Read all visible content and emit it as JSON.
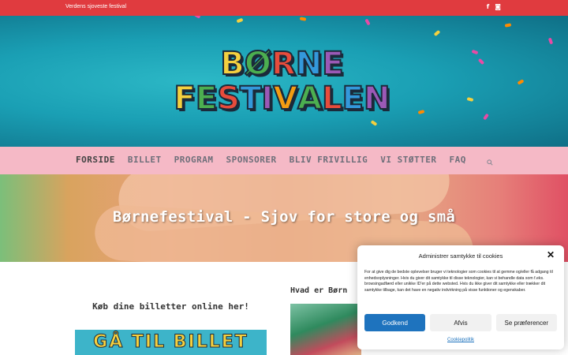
{
  "topbar": {
    "tagline": "Verdens sjoveste festival",
    "social": [
      {
        "icon": "facebook-icon",
        "glyph": "f"
      },
      {
        "icon": "instagram-icon",
        "glyph": "◙"
      }
    ]
  },
  "logo": {
    "row1": [
      "B",
      "Ø",
      "R",
      "N",
      "E"
    ],
    "row2": [
      "F",
      "E",
      "S",
      "T",
      "I",
      "V",
      "A",
      "L",
      "E",
      "N"
    ],
    "colors": [
      "#f4d03f",
      "#4caf50",
      "#e74c3c",
      "#3498db",
      "#9b59b6",
      "#f39c12"
    ]
  },
  "nav": {
    "items": [
      "FORSIDE",
      "BILLET",
      "PROGRAM",
      "SPONSORER",
      "BLIV FRIVILLIG",
      "VI STØTTER",
      "FAQ"
    ],
    "search_icon": "search-icon"
  },
  "banner": {
    "title": "Børnefestival - Sjov for store og små"
  },
  "content": {
    "buy_title": "Køb dine billetter online her!",
    "ticket_text": "GÅ TIL BILLET",
    "what_title": "Hvad er Børn"
  },
  "cookie": {
    "title": "Administrer samtykke til cookies",
    "text": "For at give dig de bedste oplevelser bruger vi teknologier som cookies til at gemme og/eller få adgang til enhedsoplysninger. Hvis du giver dit samtykke til disse teknologier, kan vi behandle data som f.eks. browsingadfærd eller unikke ID'er på dette websted. Hvis du ikke giver dit samtykke eller trækker dit samtykke tilbage, kan det have en negativ indvirkning på visse funktioner og egenskaber.",
    "accept": "Godkend",
    "deny": "Afvis",
    "prefs": "Se præferencer",
    "policy": "Cookiepolitik"
  },
  "colors": {
    "topbar": "#e03b3f",
    "nav": "#f5b9c6",
    "accent": "#1e73be"
  }
}
